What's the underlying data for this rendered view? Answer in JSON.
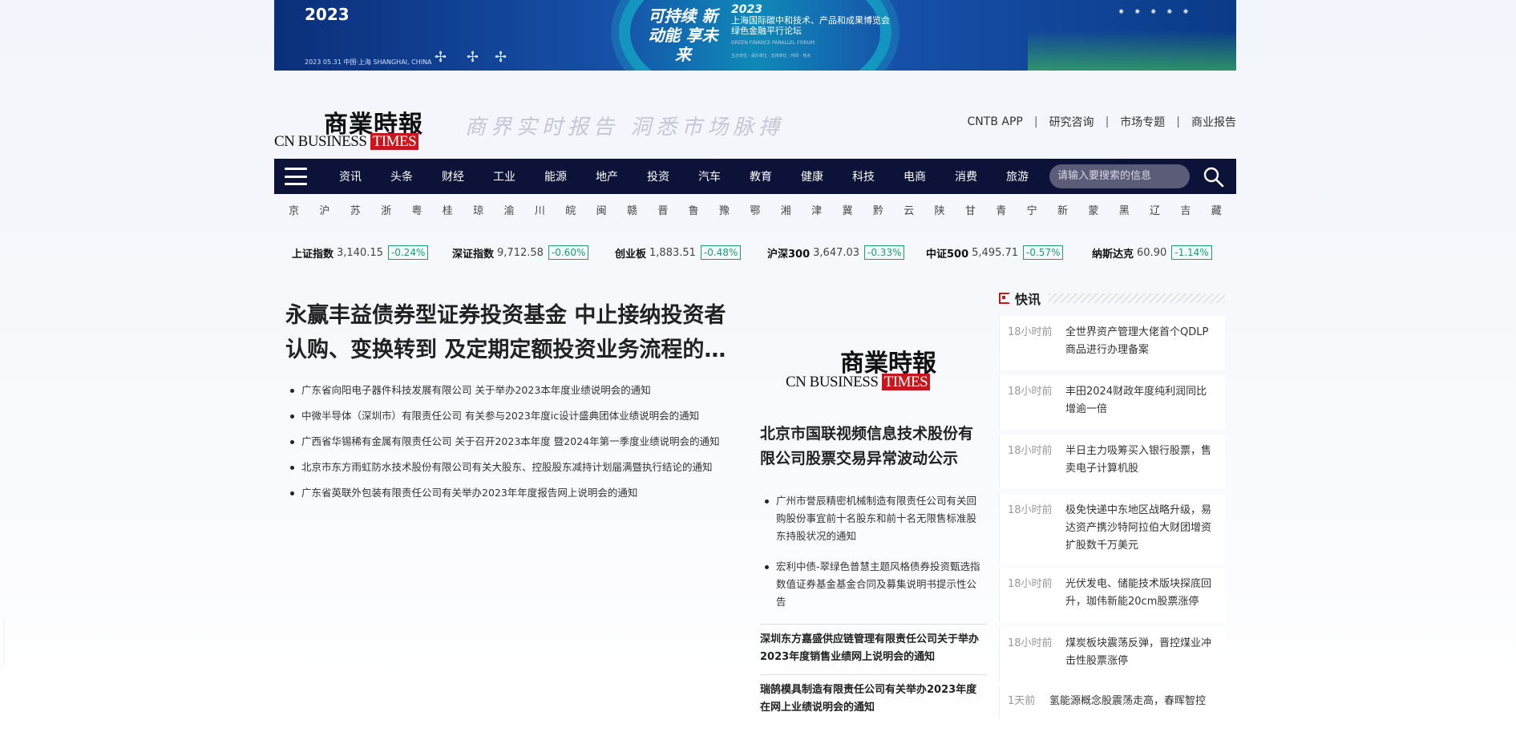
{
  "banner": {
    "year": "2023",
    "date_line": "2023 05.31 中国·上海 SHANGHAI, CHINA",
    "slogan": "可持续 新动能 享未来",
    "expo_year": "2023",
    "expo_title": "上海国际碳中和技术、产品和成果博览会",
    "expo_sub": "绿色金融平行论坛",
    "expo_en": "GREEN FINANCE PARALLEL FORUM",
    "expo_info": "主办单位 · 承办单位 · 支持单位 · 时间 · 地点"
  },
  "header": {
    "logo_cn": "商業時報",
    "logo_en": "CN BUSINESS",
    "logo_times": "TIMES",
    "tagline": "商界实时报告 洞悉市场脉搏",
    "links": [
      "CNTB APP",
      "研究咨询",
      "市场专题",
      "商业报告"
    ]
  },
  "nav": {
    "items": [
      "资讯",
      "头条",
      "财经",
      "工业",
      "能源",
      "地产",
      "投资",
      "汽车",
      "教育",
      "健康",
      "科技",
      "电商",
      "消费",
      "旅游"
    ],
    "search_placeholder": "请输入要搜索的信息"
  },
  "provinces": [
    "京",
    "沪",
    "苏",
    "浙",
    "粤",
    "桂",
    "琼",
    "渝",
    "川",
    "皖",
    "闽",
    "赣",
    "晋",
    "鲁",
    "豫",
    "鄂",
    "湘",
    "津",
    "冀",
    "黔",
    "云",
    "陕",
    "甘",
    "青",
    "宁",
    "新",
    "蒙",
    "黑",
    "辽",
    "吉",
    "藏"
  ],
  "indices": [
    {
      "name": "上证指数",
      "value": "3,140.15",
      "change": "-0.24%"
    },
    {
      "name": "深证指数",
      "value": "9,712.58",
      "change": "-0.60%"
    },
    {
      "name": "创业板",
      "value": "1,883.51",
      "change": "-0.48%"
    },
    {
      "name": "沪深300",
      "value": "3,647.03",
      "change": "-0.33%"
    },
    {
      "name": "中证500",
      "value": "5,495.71",
      "change": "-0.57%"
    },
    {
      "name": "纳斯达克",
      "value": "60.90",
      "change": "-1.14%"
    }
  ],
  "main": {
    "headline": "永赢丰益债券型证券投资基金 中止接纳投资者认购、变换转到 及定期定额投资业务流程的…",
    "list": [
      "广东省向阳电子器件科技发展有限公司 关于举办2023本年度业绩说明会的通知",
      "中微半导体（深圳市）有限责任公司 有关参与2023年度ic设计盛典团体业绩说明会的通知",
      "广西省华锡稀有金属有限责任公司 关于召开2023本年度 暨2024年第一季度业绩说明会的通知",
      "北京市东方雨虹防水技术股份有限公司有关大股东、控股股东减持计划届满暨执行结论的通知",
      "广东省英联外包装有限责任公司有关举办2023年年度报告网上说明会的通知"
    ]
  },
  "middle": {
    "title": "北京市国联视频信息技术股份有限公司股票交易异常波动公示",
    "list": [
      "广州市誉辰精密机械制造有限责任公司有关回购股份事宜前十名股东和前十名无限售标准股东持股状况的通知",
      "宏利中债-翠绿色普慧主题风格债券投资甄选指数值证券基金基金合同及募集说明书提示性公告"
    ],
    "sub1": "深圳东方嘉盛供应链管理有限责任公司关于举办2023年度销售业绩网上说明会的通知",
    "sub2": "瑞鹄模具制造有限责任公司有关举办2023年度在网上业绩说明会的通知"
  },
  "flash": {
    "title": "快讯",
    "items": [
      {
        "time": "18小时前",
        "text": "全世界资产管理大佬首个QDLP商品进行办理备案"
      },
      {
        "time": "18小时前",
        "text": "丰田2024财政年度纯利润同比增逾一倍"
      },
      {
        "time": "18小时前",
        "text": "半日主力吸筹买入银行股票，售卖电子计算机股"
      },
      {
        "time": "18小时前",
        "text": "极免快递中东地区战略升级，易达资产携沙特阿拉伯大财团增资扩股数千万美元"
      },
      {
        "time": "18小时前",
        "text": "光伏发电、储能技术版块探底回升，珈伟新能20cm股票涨停"
      },
      {
        "time": "18小时前",
        "text": "煤炭板块震荡反弹，晋控煤业冲击性股票涨停"
      },
      {
        "time": "1天前",
        "text": "氢能源概念股震荡走高，春晖智控"
      }
    ]
  },
  "colors": {
    "nav_bg": "#0d1238",
    "accent_red": "#c8161d",
    "index_green": "#1e9e6a"
  }
}
